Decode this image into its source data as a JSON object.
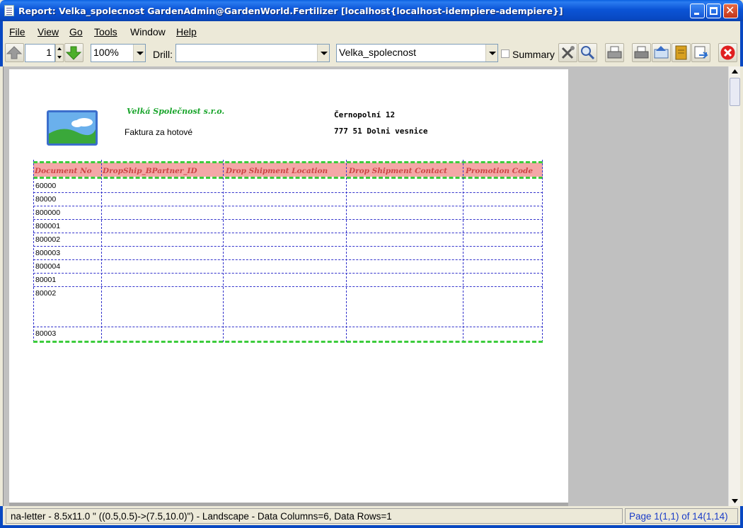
{
  "window": {
    "title": "Report: Velka_spolecnost  GardenAdmin@GardenWorld.Fertilizer [localhost{localhost-idempiere-adempiere}]"
  },
  "menu": {
    "file": "File",
    "view": "View",
    "go": "Go",
    "tools": "Tools",
    "window": "Window",
    "help": "Help"
  },
  "toolbar": {
    "page_number": "1",
    "zoom": "100%",
    "drill_label": "Drill:",
    "drill_value": "",
    "report_format": "Velka_spolecnost",
    "summary_label": "Summary"
  },
  "report": {
    "company_name": "Velká Společnost s.r.o.",
    "document_type": "Faktura za hotové",
    "address_line1": "Černopolní 12",
    "address_line2": "777 51 Dolni vesnice",
    "columns": [
      "Document No",
      "DropShip_BPartner_ID",
      "Drop Shipment Location",
      "Drop Shipment Contact",
      "Promotion Code"
    ],
    "rows": [
      "60000",
      "80000",
      "800000",
      "800001",
      "800002",
      "800003",
      "800004",
      "80001",
      "80002",
      "80003"
    ]
  },
  "status": {
    "info": "na-letter - 8.5x11.0 \" ((0.5,0.5)->(7.5,10.0)\") - Landscape - Data Columns=6, Data Rows=1",
    "page": "Page 1(1,1) of 14(1,14)"
  },
  "colors": {
    "title_bar": "#0848c2",
    "header_fill": "#f4a7a7",
    "header_text": "#cc4444",
    "green_line": "#3ccc3c",
    "grid_line": "#3333cc",
    "status_page_text": "#1a3cc8"
  }
}
